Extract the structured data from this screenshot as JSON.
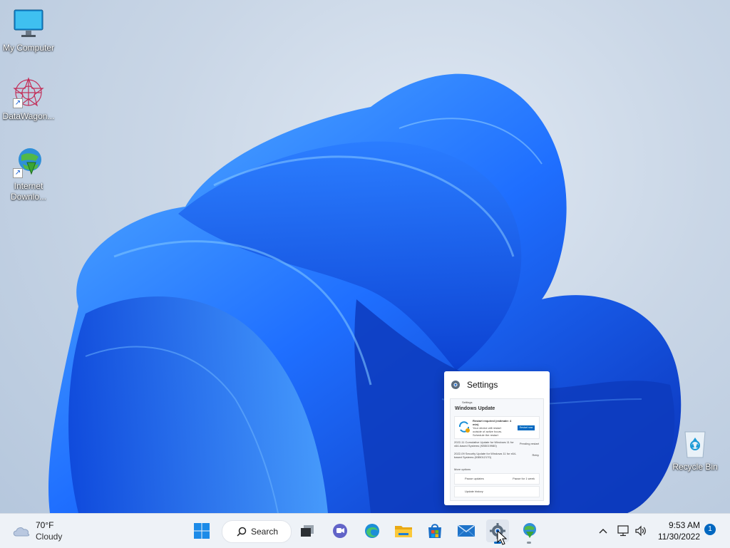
{
  "desktop": {
    "icons": [
      {
        "label": "My Computer"
      },
      {
        "label": "DataWagon..."
      },
      {
        "label_line1": "Internet",
        "label_line2": "Downlo..."
      },
      {
        "label": "Recycle Bin"
      }
    ]
  },
  "thumbnail": {
    "title": "Settings",
    "window_title": "Settings",
    "page_title": "Windows Update",
    "status_title": "Restart required (estimate: 4 min)",
    "status_desc": "Your device will restart outside of active hours.",
    "schedule_link": "Schedule the restart",
    "restart_button": "Restart now",
    "updates": [
      {
        "name": "2022-11 Cumulative Update for Windows 11 for x64-based Systems (KB5019980)",
        "status": "Pending restart"
      },
      {
        "name": "2022-09 Security Update for Windows 11 for x64-based Systems (KB5012170)",
        "status": "Retry"
      }
    ],
    "more_options": "More options",
    "pause_updates": "Pause updates",
    "pause_value": "Pause for 1 week",
    "update_history": "Update history"
  },
  "taskbar": {
    "weather": {
      "temp": "70°F",
      "condition": "Cloudy"
    },
    "search_label": "Search",
    "pinned": [
      "start-icon",
      "search",
      "task-view-icon",
      "teams-chat-icon",
      "edge-icon",
      "file-explorer-icon",
      "store-icon",
      "mail-icon",
      "settings-icon",
      "idm-icon"
    ],
    "clock": {
      "time": "9:53 AM",
      "date": "11/30/2022"
    },
    "notification_count": "1"
  },
  "colors": {
    "accent": "#0067c0",
    "taskbar_bg": "#eef2f7",
    "bloom_dark": "#0a3fc8",
    "bloom_light": "#3ea0ff"
  }
}
